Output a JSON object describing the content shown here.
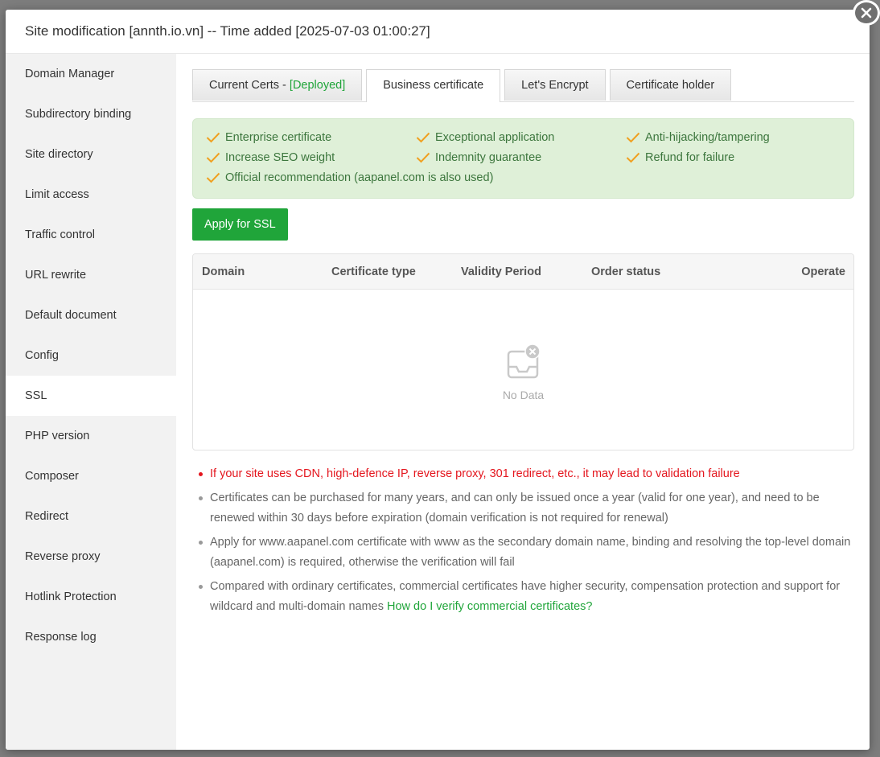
{
  "modal": {
    "title": "Site modification [annth.io.vn] -- Time added [2025-07-03 01:00:27]"
  },
  "sidebar": {
    "items": [
      {
        "label": "Domain Manager"
      },
      {
        "label": "Subdirectory binding"
      },
      {
        "label": "Site directory"
      },
      {
        "label": "Limit access"
      },
      {
        "label": "Traffic control"
      },
      {
        "label": "URL rewrite"
      },
      {
        "label": "Default document"
      },
      {
        "label": "Config"
      },
      {
        "label": "SSL"
      },
      {
        "label": "PHP version"
      },
      {
        "label": "Composer"
      },
      {
        "label": "Redirect"
      },
      {
        "label": "Reverse proxy"
      },
      {
        "label": "Hotlink Protection"
      },
      {
        "label": "Response log"
      }
    ],
    "active": "SSL"
  },
  "tabs": {
    "current_certs": "Current Certs - ",
    "current_status": "[Deployed]",
    "business": "Business certificate",
    "letsencrypt": "Let's Encrypt",
    "holder": "Certificate holder",
    "active": "Business certificate"
  },
  "features": [
    "Enterprise certificate",
    "Exceptional application",
    "Anti-hijacking/tampering",
    "Increase SEO weight",
    "Indemnity guarantee",
    "Refund for failure",
    "Official recommendation (aapanel.com is also used)"
  ],
  "apply_button": "Apply for SSL",
  "table": {
    "headers": [
      "Domain",
      "Certificate type",
      "Validity Period",
      "Order status",
      "Operate"
    ],
    "rows": [],
    "empty_text": "No Data"
  },
  "notes": {
    "warning": "If your site uses CDN, high-defence IP, reverse proxy, 301 redirect, etc., it may lead to validation failure",
    "note1": "Certificates can be purchased for many years, and can only be issued once a year (valid for one year), and need to be renewed within 30 days before expiration (domain verification is not required for renewal)",
    "note2": "Apply for www.aapanel.com certificate with www as the secondary domain name, binding and resolving the top-level domain (aapanel.com) is required, otherwise the verification will fail",
    "note3": "Compared with ordinary certificates, commercial certificates have higher security, compensation protection and support for wildcard and multi-domain names ",
    "note3_link": "How do I verify commercial certificates?"
  },
  "colors": {
    "accent": "#20a53a",
    "warning": "#e4161e",
    "feature_bg": "#dff0d8",
    "check": "#f0a020"
  },
  "icons": {
    "close": "close-icon",
    "check": "checkmark-icon",
    "empty": "empty-inbox-icon"
  }
}
